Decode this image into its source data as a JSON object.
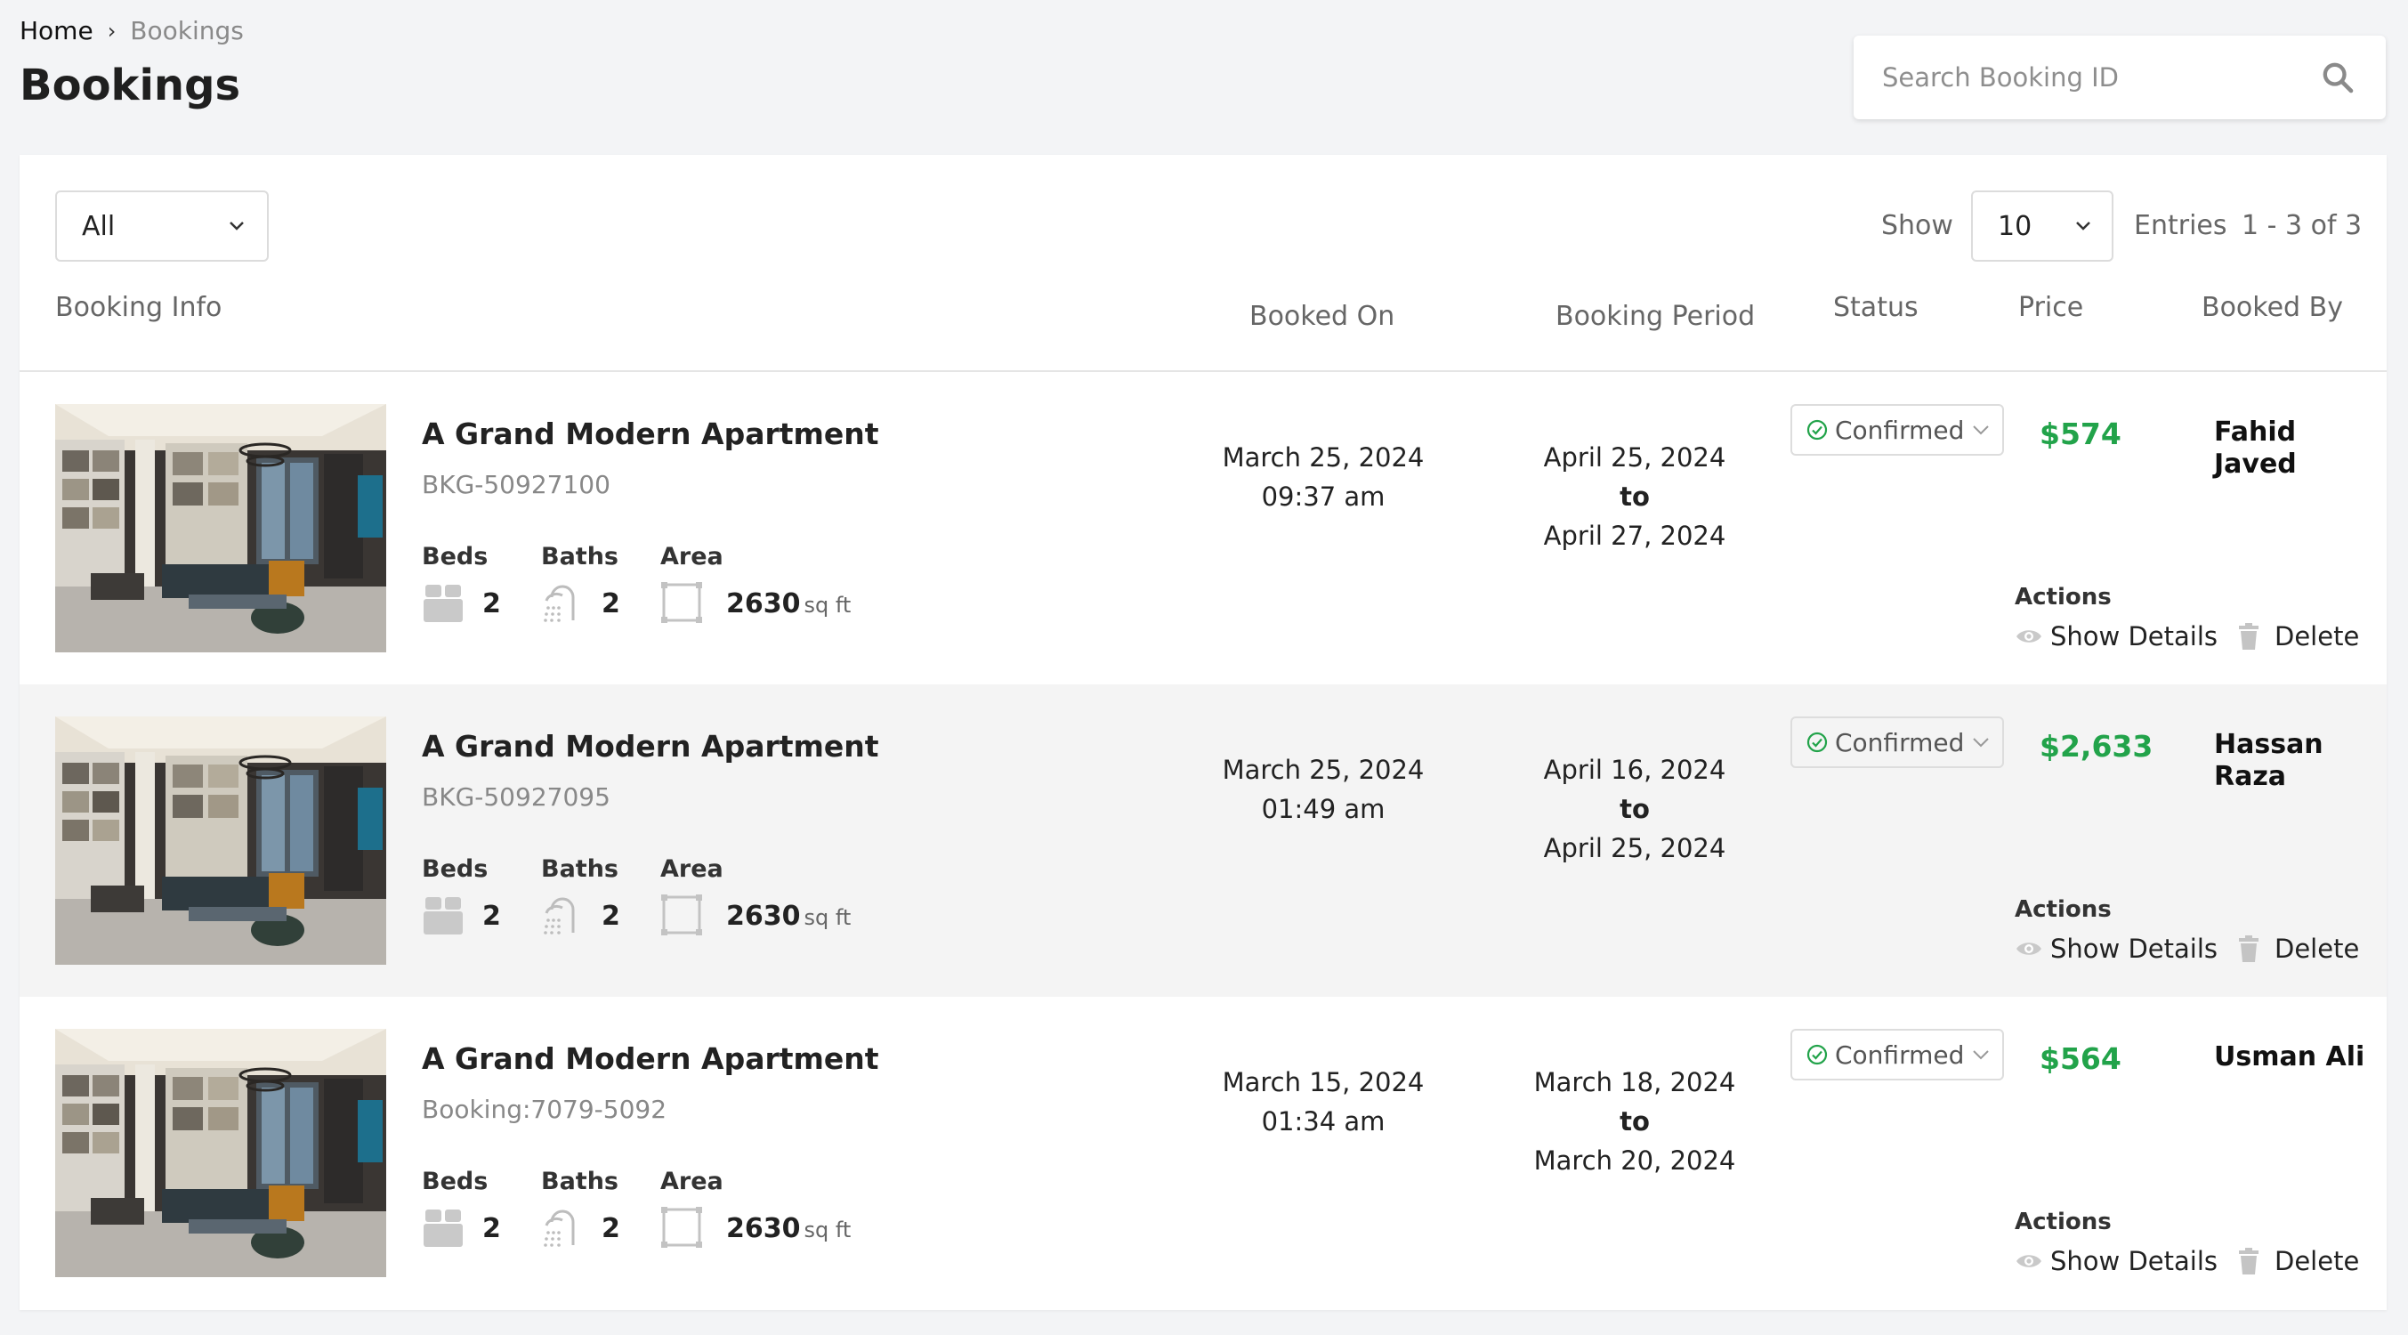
{
  "breadcrumb": {
    "home": "Home",
    "current": "Bookings"
  },
  "page_title": "Bookings",
  "search": {
    "placeholder": "Search Booking ID"
  },
  "filter": {
    "selected": "All"
  },
  "pagination": {
    "show_label": "Show",
    "entries_value": "10",
    "entries_label": "Entries",
    "range": "1 - 3 of 3"
  },
  "columns": {
    "booking_info": "Booking Info",
    "booked_on": "Booked On",
    "booking_period": "Booking Period",
    "status": "Status",
    "price": "Price",
    "booked_by": "Booked By"
  },
  "labels": {
    "beds": "Beds",
    "baths": "Baths",
    "area": "Area",
    "sqft": "sq ft",
    "to": "to",
    "actions": "Actions",
    "show_details": "Show Details",
    "delete": "Delete"
  },
  "colors": {
    "price": "#22a34a",
    "status_check": "#22a34a",
    "alt_row": "#f4f4f4"
  },
  "bookings": [
    {
      "title": "A Grand Modern Apartment",
      "id": "BKG-50927100",
      "beds": "2",
      "baths": "2",
      "area": "2630",
      "booked_date": "March 25, 2024",
      "booked_time": "09:37 am",
      "period_start": "April 25, 2024",
      "period_end": "April 27, 2024",
      "status": "Confirmed",
      "price": "$574",
      "booked_by_first": "Fahid",
      "booked_by_last": "Javed"
    },
    {
      "title": "A Grand Modern Apartment",
      "id": "BKG-50927095",
      "beds": "2",
      "baths": "2",
      "area": "2630",
      "booked_date": "March 25, 2024",
      "booked_time": "01:49 am",
      "period_start": "April 16, 2024",
      "period_end": "April 25, 2024",
      "status": "Confirmed",
      "price": "$2,633",
      "booked_by_first": "Hassan",
      "booked_by_last": "Raza"
    },
    {
      "title": "A Grand Modern Apartment",
      "id": "Booking:7079-5092",
      "beds": "2",
      "baths": "2",
      "area": "2630",
      "booked_date": "March 15, 2024",
      "booked_time": "01:34 am",
      "period_start": "March 18, 2024",
      "period_end": "March 20, 2024",
      "status": "Confirmed",
      "price": "$564",
      "booked_by_first": "Usman Ali",
      "booked_by_last": ""
    }
  ]
}
